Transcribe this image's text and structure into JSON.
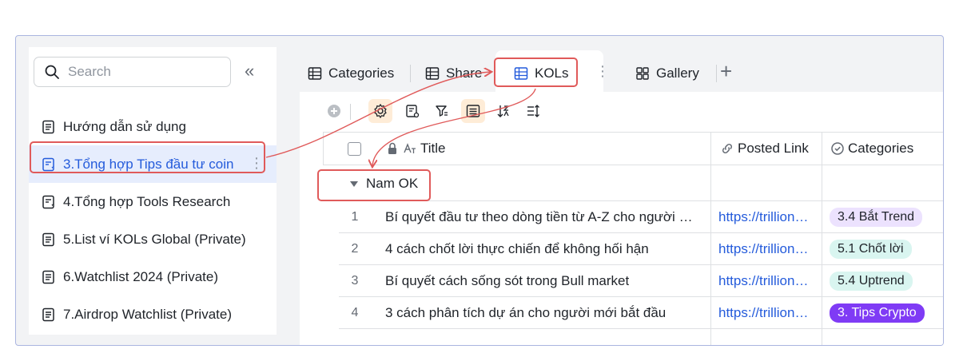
{
  "sidebar": {
    "search_placeholder": "Search",
    "collapse_glyph": "«",
    "items": [
      {
        "label": "Hướng dẫn sử dụng",
        "icon": "doc-icon"
      },
      {
        "label": "3.Tổng hợp Tips đầu tư coin",
        "icon": "table-doc-icon",
        "active": true
      },
      {
        "label": "4.Tổng hợp Tools Research",
        "icon": "table-doc-icon"
      },
      {
        "label": "5.List ví KOLs Global (Private)",
        "icon": "doc-icon"
      },
      {
        "label": "6.Watchlist 2024 (Private)",
        "icon": "doc-icon"
      },
      {
        "label": "7.Airdrop Watchlist (Private)",
        "icon": "doc-icon"
      }
    ],
    "more_glyph": "⋮"
  },
  "tabs": [
    {
      "label": "Categories",
      "icon": "grid-icon"
    },
    {
      "label": "Share",
      "icon": "grid-icon"
    },
    {
      "label": "KOLs",
      "icon": "grid-icon",
      "active": true
    },
    {
      "label": "Gallery",
      "icon": "gallery-icon"
    }
  ],
  "tab_more_glyph": "⋮",
  "tab_add_glyph": "+",
  "table": {
    "columns": [
      "Title",
      "Posted Link",
      "Categories"
    ],
    "group": "Nam OK",
    "rows": [
      {
        "num": "1",
        "title": "Bí quyết đầu tư theo dòng tiền từ A-Z cho người mới bắt đầu",
        "link": "https://trillionaire.vn",
        "category": "3.4 Bắt Trend",
        "tag_bg": "#ece2fe",
        "tag_fg": "#1f2329"
      },
      {
        "num": "2",
        "title": "4 cách chốt lời thực chiến để không hối hận",
        "link": "https://trillionaire.vn",
        "category": "5.1 Chốt lời",
        "tag_bg": "#d9f5f0",
        "tag_fg": "#1f2329"
      },
      {
        "num": "3",
        "title": "Bí quyết cách sống sót trong Bull market",
        "link": "https://trillionaire.vn",
        "category": "5.4 Uptrend",
        "tag_bg": "#d9f5f0",
        "tag_fg": "#1f2329"
      },
      {
        "num": "4",
        "title": "3 cách phân tích dự án cho người mới bắt đầu",
        "link": "https://trillionaire.vn",
        "category": "3. Tips Crypto",
        "tag_bg": "#7f3bf5",
        "tag_fg": "#ffffff"
      }
    ]
  },
  "colors": {
    "accent": "#245bdb",
    "highlight": "#e05a5a"
  }
}
